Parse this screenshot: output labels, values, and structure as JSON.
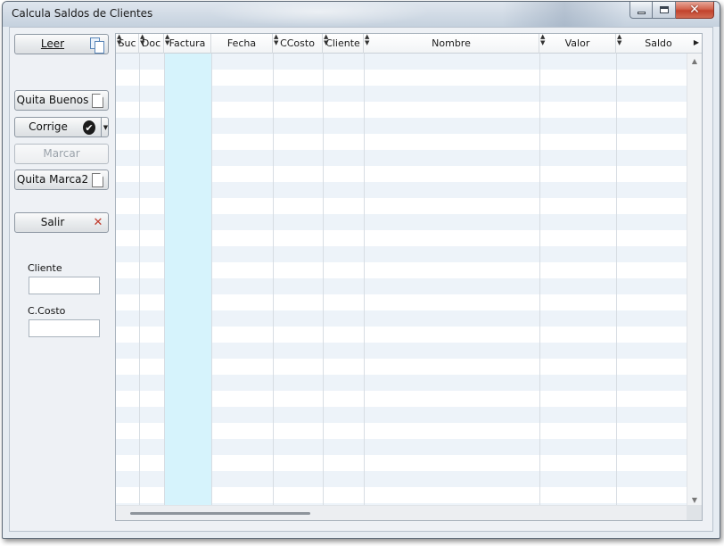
{
  "window": {
    "title": "Calcula Saldos de Clientes",
    "caption": {
      "minimize": "minimize",
      "maximize": "maximize",
      "close": "✕"
    }
  },
  "sidebar": {
    "leer": "Leer",
    "quita_buenos": "Quita Buenos",
    "corrige": "Corrige",
    "marcar": "Marcar",
    "quita_marca2": "Quita Marca2",
    "salir": "Salir",
    "cliente_label": "Cliente",
    "cliente_value": "",
    "ccosto_label": "C.Costo",
    "ccosto_value": ""
  },
  "grid": {
    "columns": [
      "Suc",
      "Doc",
      "Factura",
      "Fecha",
      "CCosto",
      "Cliente",
      "Nombre",
      "Valor",
      "Saldo"
    ],
    "rows": []
  },
  "colors": {
    "accent_selected_column": "#d6f3fc",
    "alt_row": "#edf3f9",
    "close_button": "#c2422c"
  },
  "icons": {
    "leer": "copy-icon",
    "quita_buenos": "document-icon",
    "corrige": "check-circle-icon",
    "quita_marca2": "document-icon",
    "salir": "close-x-icon"
  }
}
